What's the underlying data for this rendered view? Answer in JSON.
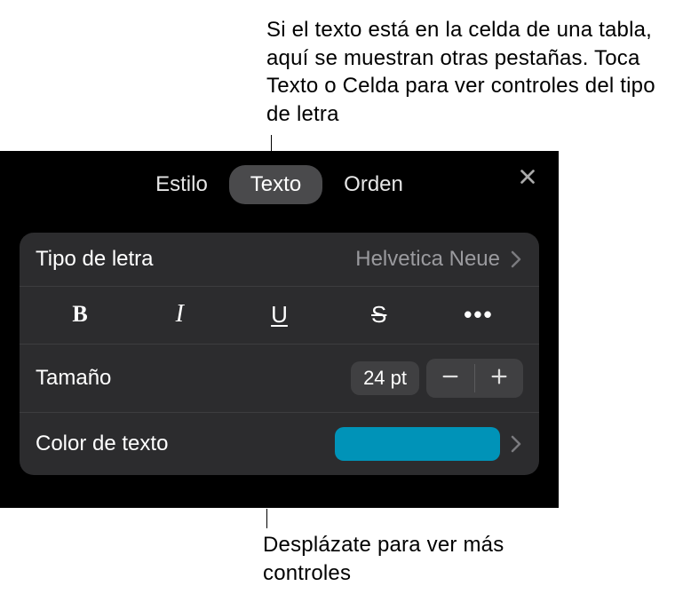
{
  "callouts": {
    "top": "Si el texto está en la celda de una tabla, aquí se muestran otras pestañas. Toca Texto o Celda para ver controles del tipo de letra",
    "bottom": "Desplázate para ver más controles"
  },
  "tabs": {
    "style": "Estilo",
    "text": "Texto",
    "order": "Orden"
  },
  "font_row": {
    "label": "Tipo de letra",
    "value": "Helvetica Neue"
  },
  "style_buttons": {
    "bold": "B",
    "italic": "I",
    "underline": "U",
    "strike": "S",
    "more": "•••"
  },
  "size_row": {
    "label": "Tamaño",
    "value": "24 pt"
  },
  "color_row": {
    "label": "Color de texto",
    "swatch_hex": "#0093b8"
  }
}
